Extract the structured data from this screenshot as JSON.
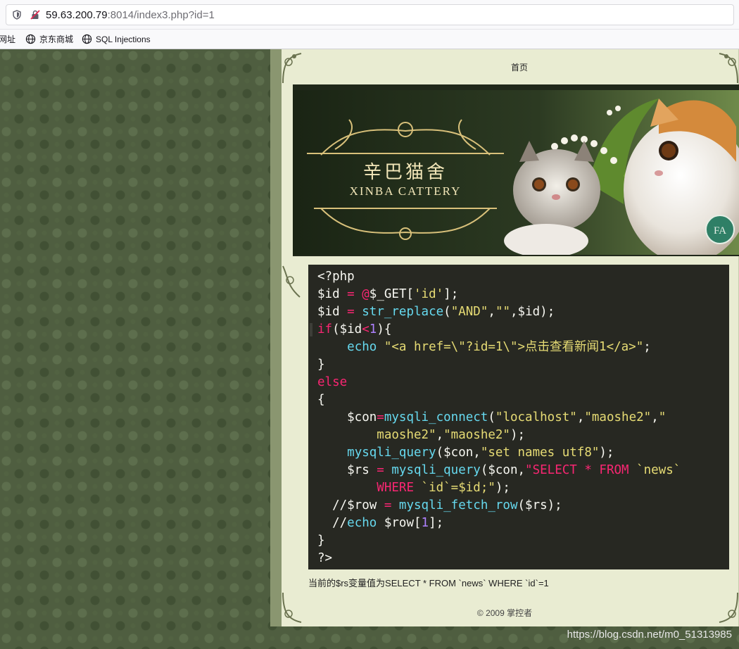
{
  "browser": {
    "url_host": "59.63.200.79",
    "url_rest": ":8014/index3.php?id=1",
    "bookmarks": [
      "网址",
      "京东商城",
      "SQL Injections"
    ]
  },
  "site": {
    "nav_home": "首页",
    "banner_title": "辛巴猫舍",
    "banner_subtitle": "XINBA CATTERY",
    "code_lines": [
      [
        [
          "pl",
          "<?php"
        ]
      ],
      [
        [
          "pl",
          "$id "
        ],
        [
          "kw",
          "="
        ],
        [
          "pl",
          " "
        ],
        [
          "kw",
          "@"
        ],
        [
          "pl",
          "$_GET["
        ],
        [
          "str",
          "'id'"
        ],
        [
          "pl",
          "];"
        ]
      ],
      [
        [
          "pl",
          "$id "
        ],
        [
          "kw",
          "="
        ],
        [
          "pl",
          " "
        ],
        [
          "fn",
          "str_replace"
        ],
        [
          "pl",
          "("
        ],
        [
          "str",
          "\"AND\""
        ],
        [
          "pl",
          ","
        ],
        [
          "str",
          "\"\""
        ],
        [
          "pl",
          ",$id);"
        ]
      ],
      [
        [
          "kw",
          "if"
        ],
        [
          "pl",
          "($id"
        ],
        [
          "kw",
          "<"
        ],
        [
          "num",
          "1"
        ],
        [
          "pl",
          "){"
        ]
      ],
      [
        [
          "pl",
          "    "
        ],
        [
          "fn",
          "echo"
        ],
        [
          "pl",
          " "
        ],
        [
          "str",
          "\"<a href=\\\"?id=1\\\">点击查看新闻1</a>\""
        ],
        [
          "pl",
          ";"
        ]
      ],
      [
        [
          "pl",
          "}"
        ]
      ],
      [
        [
          "kw",
          "else"
        ]
      ],
      [
        [
          "pl",
          "{"
        ]
      ],
      [
        [
          "pl",
          "    $con"
        ],
        [
          "kw",
          "="
        ],
        [
          "fn",
          "mysqli_connect"
        ],
        [
          "pl",
          "("
        ],
        [
          "str",
          "\"localhost\""
        ],
        [
          "pl",
          ","
        ],
        [
          "str",
          "\"maoshe2\""
        ],
        [
          "pl",
          ","
        ],
        [
          "str",
          "\""
        ]
      ],
      [
        [
          "pl",
          "        "
        ],
        [
          "str",
          "maoshe2\""
        ],
        [
          "pl",
          ","
        ],
        [
          "str",
          "\"maoshe2\""
        ],
        [
          "pl",
          ");"
        ]
      ],
      [
        [
          "pl",
          "    "
        ],
        [
          "fn",
          "mysqli_query"
        ],
        [
          "pl",
          "($con,"
        ],
        [
          "str",
          "\"set names utf8\""
        ],
        [
          "pl",
          ");"
        ]
      ],
      [
        [
          "pl",
          "    $rs "
        ],
        [
          "kw",
          "="
        ],
        [
          "pl",
          " "
        ],
        [
          "fn",
          "mysqli_query"
        ],
        [
          "pl",
          "($con,"
        ],
        [
          "kw",
          "\"SELECT * FROM "
        ],
        [
          "str",
          "`news`"
        ]
      ],
      [
        [
          "pl",
          "        "
        ],
        [
          "kw",
          "WHERE"
        ],
        [
          "pl",
          " "
        ],
        [
          "str",
          "`id`=$id;\""
        ],
        [
          "pl",
          ");"
        ]
      ],
      [
        [
          "pl",
          "  //$row "
        ],
        [
          "kw",
          "="
        ],
        [
          "pl",
          " "
        ],
        [
          "fn",
          "mysqli_fetch_row"
        ],
        [
          "pl",
          "($rs);"
        ]
      ],
      [
        [
          "pl",
          "  //"
        ],
        [
          "fn",
          "echo"
        ],
        [
          "pl",
          " $row["
        ],
        [
          "num",
          "1"
        ],
        [
          "pl",
          "];"
        ]
      ],
      [
        [
          "pl",
          "}"
        ]
      ],
      [
        [
          "pl",
          "?>"
        ]
      ]
    ],
    "output_text": "当前的$rs变量值为SELECT * FROM `news` WHERE `id`=1",
    "footer": "© 2009 掌控者"
  },
  "watermark": "https://blog.csdn.net/m0_51313985"
}
